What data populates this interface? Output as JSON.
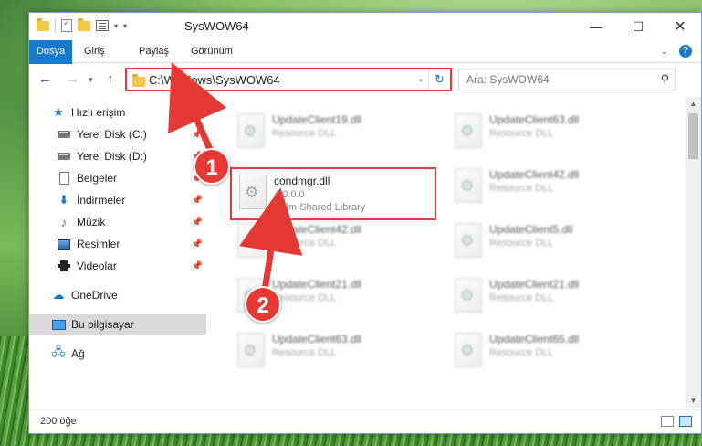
{
  "window": {
    "title": "SysWOW64"
  },
  "ribbon": {
    "tabs": [
      "Dosya",
      "Giriş",
      "Paylaş",
      "Görünüm"
    ]
  },
  "nav": {
    "address": "C:\\Windows\\SysWOW64",
    "search_placeholder": "Ara: SysWOW64"
  },
  "sidebar": {
    "items": [
      {
        "label": "Hızlı erişim",
        "icon": "star-icon"
      },
      {
        "label": "Yerel Disk (C:)",
        "icon": "drive-icon"
      },
      {
        "label": "Yerel Disk (D:)",
        "icon": "drive-icon"
      },
      {
        "label": "Belgeler",
        "icon": "documents-icon"
      },
      {
        "label": "İndirmeler",
        "icon": "download-icon"
      },
      {
        "label": "Müzik",
        "icon": "music-icon"
      },
      {
        "label": "Resimler",
        "icon": "pictures-icon"
      },
      {
        "label": "Videolar",
        "icon": "videos-icon"
      },
      {
        "label": "OneDrive",
        "icon": "cloud-icon"
      },
      {
        "label": "Bu bilgisayar",
        "icon": "computer-icon"
      },
      {
        "label": "Ağ",
        "icon": "network-icon"
      }
    ]
  },
  "files": {
    "left": [
      {
        "name": "UpdateClient19.dll",
        "desc": "Resource DLL"
      },
      {
        "name": "UpdateClient42.dll",
        "desc": "Resource DLL"
      },
      {
        "name": "UpdateClient21.dll",
        "desc": "Resource DLL"
      },
      {
        "name": "UpdateClient63.dll",
        "desc": "Resource DLL"
      }
    ],
    "right": [
      {
        "name": "UpdateClient63.dll",
        "desc": "Resource DLL"
      },
      {
        "name": "UpdateClient42.dll",
        "desc": "Resource DLL"
      },
      {
        "name": "UpdateClient5.dll",
        "desc": "Resource DLL"
      },
      {
        "name": "UpdateClient21.dll",
        "desc": "Resource DLL"
      },
      {
        "name": "UpdateClient65.dll",
        "desc": "Resource DLL"
      }
    ],
    "highlighted": {
      "name": "condmgr.dll",
      "version": "4.0.0.0",
      "desc": "Palm Shared Library"
    }
  },
  "status": {
    "count": "200 öğe"
  },
  "callouts": {
    "one": "1",
    "two": "2"
  },
  "colors": {
    "accent": "#1979ca",
    "callout": "#e53935"
  }
}
